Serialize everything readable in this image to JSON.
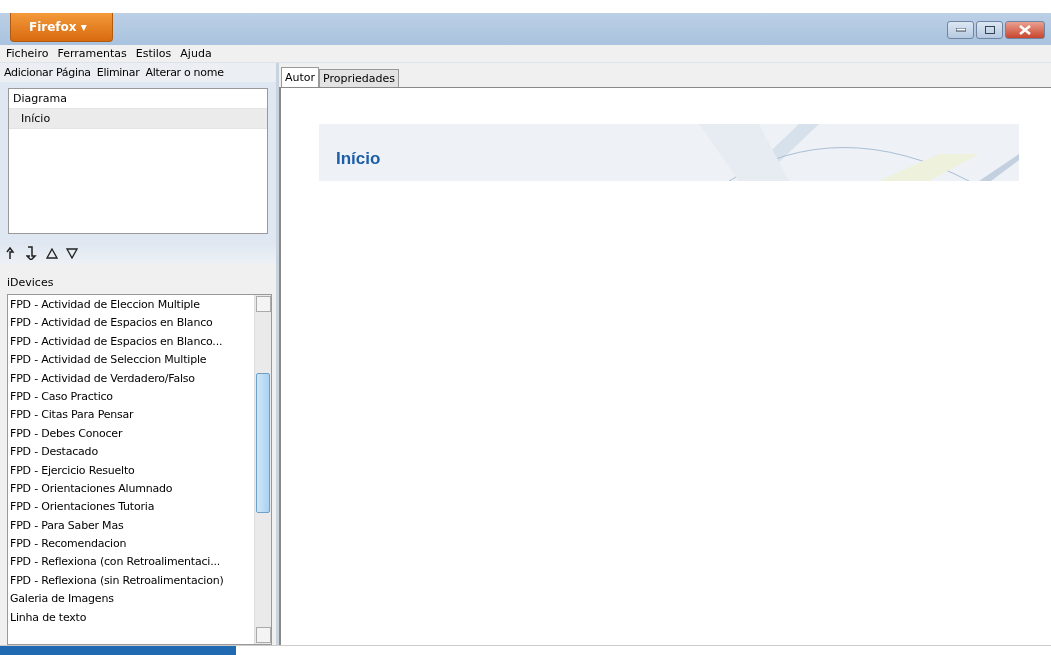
{
  "app_button": {
    "label": "Firefox ▾"
  },
  "window_controls": [
    {
      "kind": "minimize"
    },
    {
      "kind": "maximize"
    },
    {
      "kind": "close"
    }
  ],
  "menu": [
    "Ficheiro",
    "Ferramentas",
    "Estilos",
    "Ajuda"
  ],
  "outline_toolbar": [
    "Adicionar Página",
    "Eliminar",
    "Alterar o nome"
  ],
  "outline": {
    "label": "Diagrama",
    "selected": false,
    "children": [
      {
        "label": "Início",
        "selected": true
      }
    ]
  },
  "move_buttons": [
    {
      "kind": "promote"
    },
    {
      "kind": "demote"
    },
    {
      "kind": "up"
    },
    {
      "kind": "down"
    }
  ],
  "idevices": {
    "title": "iDevices",
    "items": [
      "FPD - Actividad de Eleccion Multiple",
      "FPD - Actividad de Espacios en Blanco",
      "FPD - Actividad de Espacios en Blanco...",
      "FPD - Actividad de Seleccion Multiple",
      "FPD - Actividad de Verdadero/Falso",
      "FPD - Caso Practico",
      "FPD - Citas Para Pensar",
      "FPD - Debes Conocer",
      "FPD - Destacado",
      "FPD - Ejercicio Resuelto",
      "FPD - Orientaciones Alumnado",
      "FPD - Orientaciones Tutoria",
      "FPD - Para Saber Mas",
      "FPD - Recomendacion",
      "FPD - Reflexiona (con Retroalimentaci...",
      "FPD - Reflexiona (sin Retroalimentacion)",
      "Galeria de Imagens",
      "Linha de texto"
    ]
  },
  "tabs": [
    {
      "label": "Autor",
      "selected": true
    },
    {
      "label": "Propriedades",
      "selected": false
    }
  ],
  "page_header": {
    "title": "Início"
  }
}
